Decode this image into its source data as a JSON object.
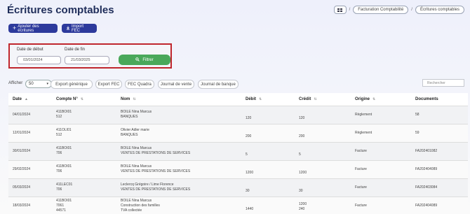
{
  "page": {
    "title": "Écritures comptables"
  },
  "breadcrumb": {
    "items": [
      "Facturation Comptabilité",
      "Écritures comptables"
    ],
    "separator": "/"
  },
  "actions": {
    "add_label": "Ajouter des écritures",
    "add_icon": "plus-icon",
    "import_label": "Import FEC",
    "import_icon": "download-icon"
  },
  "filter": {
    "start_label": "Date de début",
    "start_value": "03/01/2024",
    "end_label": "Date de fin",
    "end_value": "21/03/2025",
    "button_label": "Filtrer",
    "button_icon": "search-icon"
  },
  "toolbar": {
    "show_label": "Afficher",
    "page_size": "50",
    "buttons": [
      "Export générique",
      "Export FEC",
      "FEC Quadra",
      "Journal de vente",
      "Journal de banque"
    ],
    "search_placeholder": "Rechercher"
  },
  "table": {
    "columns": [
      "Date",
      "Compte N°",
      "Nom",
      "Débit",
      "Crédit",
      "Origine",
      "Documents"
    ],
    "rows": [
      {
        "date": "04/01/2024",
        "compte": [
          "411BOI01",
          "512"
        ],
        "nom": [
          "BOILE Nina Marcus",
          "BANQUES"
        ],
        "debit": [
          "120"
        ],
        "credit": [
          "120"
        ],
        "origine": "Règlement",
        "document": "58"
      },
      {
        "date": "12/01/2024",
        "compte": [
          "411OLI01",
          "512"
        ],
        "nom": [
          "Olivier Adler marie",
          "BANQUES"
        ],
        "debit": [
          "200"
        ],
        "credit": [
          "200"
        ],
        "origine": "Règlement",
        "document": "59"
      },
      {
        "date": "30/01/2024",
        "compte": [
          "411BOI01",
          "706"
        ],
        "nom": [
          "BOILE Nina Marcus",
          "VENTES DE PRESTATIONS DE SERVICES"
        ],
        "debit": [
          "5"
        ],
        "credit": [
          "5"
        ],
        "origine": "Facture",
        "document": "FA202401082"
      },
      {
        "date": "29/02/2024",
        "compte": [
          "411BOI01",
          "706"
        ],
        "nom": [
          "BOILE Nina Marcus",
          "VENTES DE PRESTATIONS DE SERVICES"
        ],
        "debit": [
          "1200"
        ],
        "credit": [
          "1200"
        ],
        "origine": "Facture",
        "document": "FA202404089"
      },
      {
        "date": "05/03/2024",
        "compte": [
          "411LEC01",
          "706"
        ],
        "nom": [
          "Leclercq Grégoire / Lime Florence",
          "VENTES DE PRESTATIONS DE SERVICES"
        ],
        "debit": [
          "30"
        ],
        "credit": [
          "30"
        ],
        "origine": "Facture",
        "document": "FA202403084"
      },
      {
        "date": "18/03/2024",
        "compte": [
          "411BOI01",
          "7061",
          "44571"
        ],
        "nom": [
          "BOILE Nina Marcus",
          "Construction des familles",
          "TVA collectée"
        ],
        "debit": [
          "1440"
        ],
        "credit": [
          "1200",
          "240"
        ],
        "origine": "Facture",
        "document": "FA202404089"
      }
    ]
  },
  "colors": {
    "primary": "#2d3a9c",
    "filter_button": "#4aa85a",
    "highlight_border": "#c0262d"
  }
}
